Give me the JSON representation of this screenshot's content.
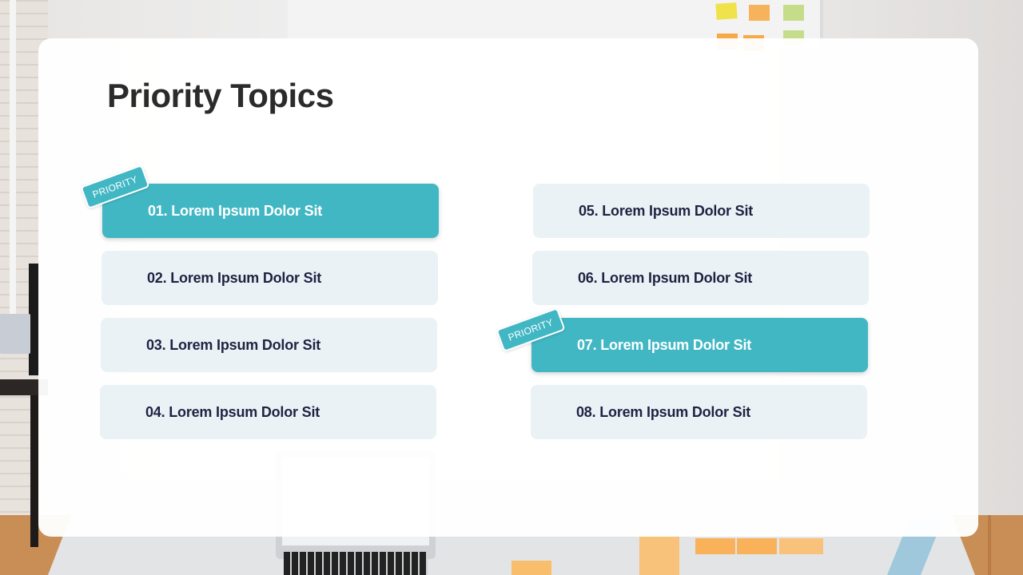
{
  "slide": {
    "title": "Priority Topics"
  },
  "colors": {
    "accent": "#42b7c4",
    "item_background": "#eaf2f6",
    "item_text": "#1f2341",
    "title_text": "#2b2b2b"
  },
  "badge_label": "PRIORITY",
  "topics": [
    {
      "label": "01. Lorem Ipsum Dolor Sit",
      "priority": true
    },
    {
      "label": "02. Lorem Ipsum Dolor Sit",
      "priority": false
    },
    {
      "label": "03. Lorem Ipsum Dolor Sit",
      "priority": false
    },
    {
      "label": "04. Lorem Ipsum Dolor Sit",
      "priority": false
    },
    {
      "label": "05. Lorem Ipsum Dolor Sit",
      "priority": false
    },
    {
      "label": "06. Lorem Ipsum Dolor Sit",
      "priority": false
    },
    {
      "label": "07. Lorem Ipsum Dolor Sit",
      "priority": true
    },
    {
      "label": "08. Lorem Ipsum Dolor Sit",
      "priority": false
    }
  ]
}
